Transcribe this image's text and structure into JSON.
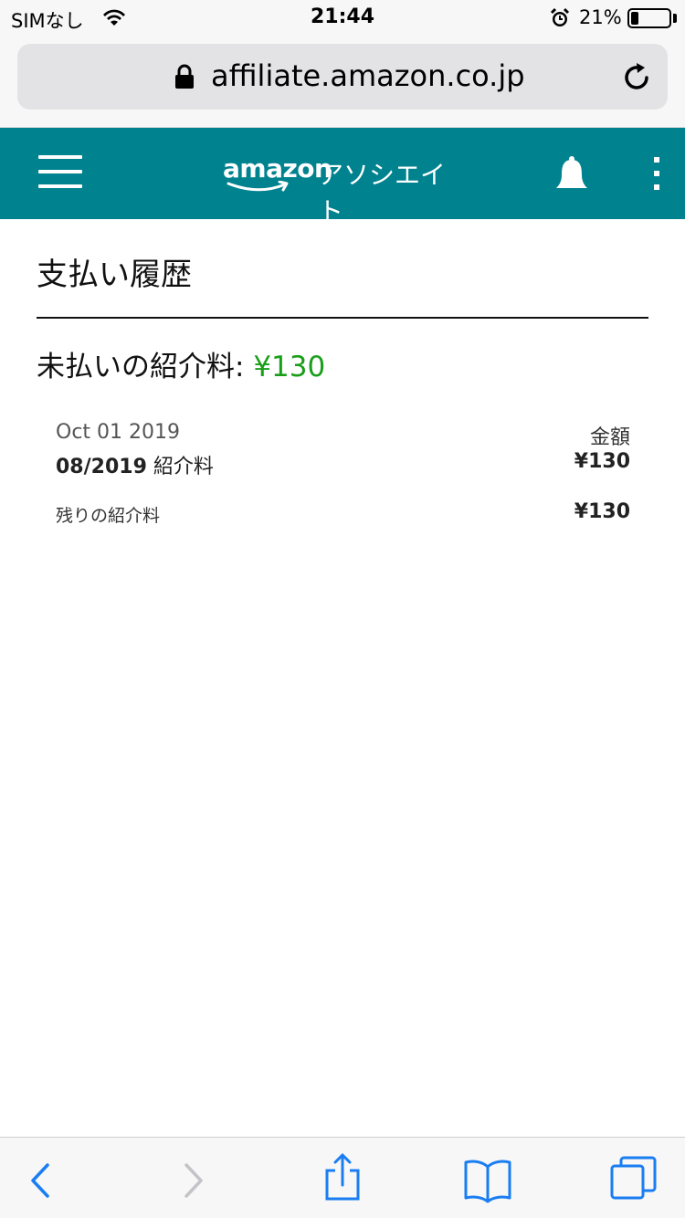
{
  "status_bar": {
    "carrier": "SIMなし",
    "time": "21:44",
    "battery_percent": "21%",
    "battery_level": 0.21
  },
  "browser": {
    "url": "affiliate.amazon.co.jp"
  },
  "nav": {
    "logo_brand": "amazon",
    "logo_suffix": "アソシエイト",
    "accent_color": "#00828f"
  },
  "page": {
    "title": "支払い履歴",
    "unpaid_label": "未払いの紹介料: ",
    "unpaid_amount": "¥130",
    "unpaid_color": "#1a9e1a"
  },
  "payment": {
    "date": "Oct 01 2019",
    "amount_header": "金額",
    "period_bold": "08/2019",
    "period_suffix": " 紹介料",
    "period_amount": "¥130",
    "remaining_label": "残りの紹介料",
    "remaining_amount": "¥130"
  },
  "toolbar": {
    "icons": [
      "back-icon",
      "forward-icon",
      "share-icon",
      "bookmarks-icon",
      "tabs-icon"
    ],
    "icon_color": "#1a7ef2"
  }
}
